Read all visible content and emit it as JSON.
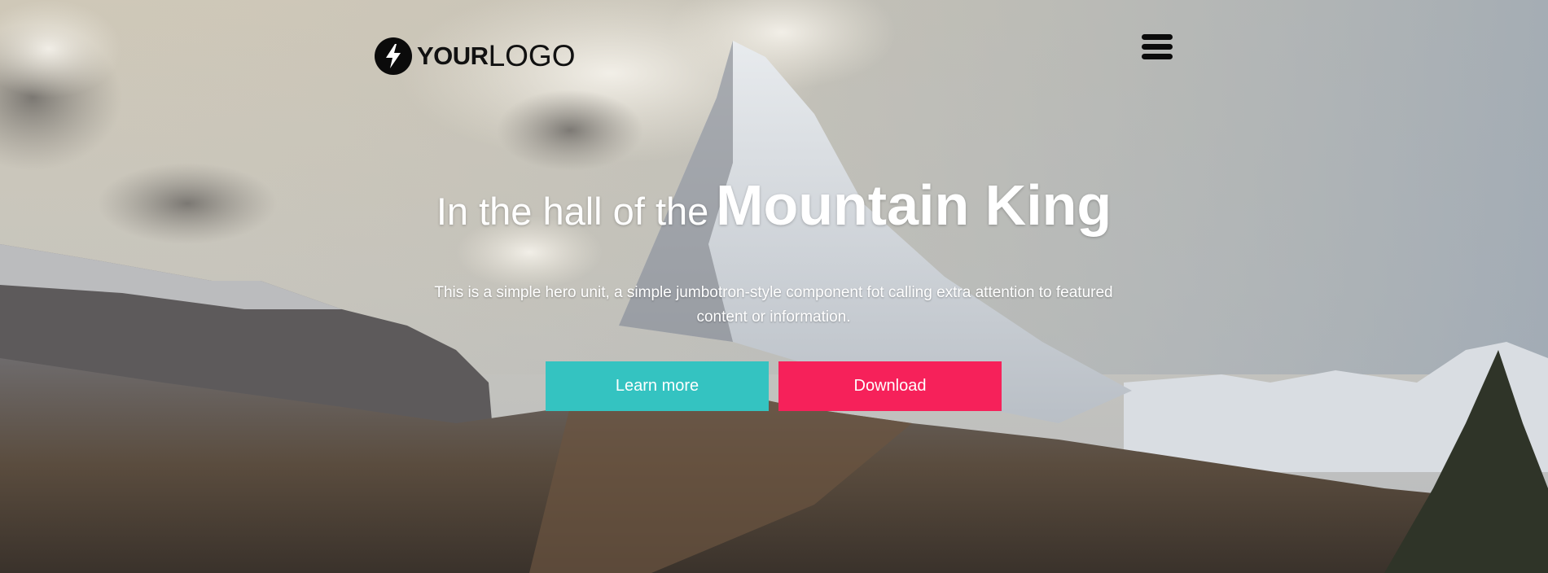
{
  "header": {
    "logo_bold": "YOUR",
    "logo_light": "LOGO",
    "logo_icon": "lightning-bolt-icon",
    "menu_icon": "hamburger-menu-icon"
  },
  "hero": {
    "title_light": "In the hall of the",
    "title_bold": "Mountain King",
    "lead": "This is a simple hero unit, a simple jumbotron-style component fot calling extra attention to featured content or information.",
    "buttons": [
      {
        "label": "Learn more",
        "color": "#34c3c1"
      },
      {
        "label": "Download",
        "color": "#f6215a"
      }
    ]
  }
}
